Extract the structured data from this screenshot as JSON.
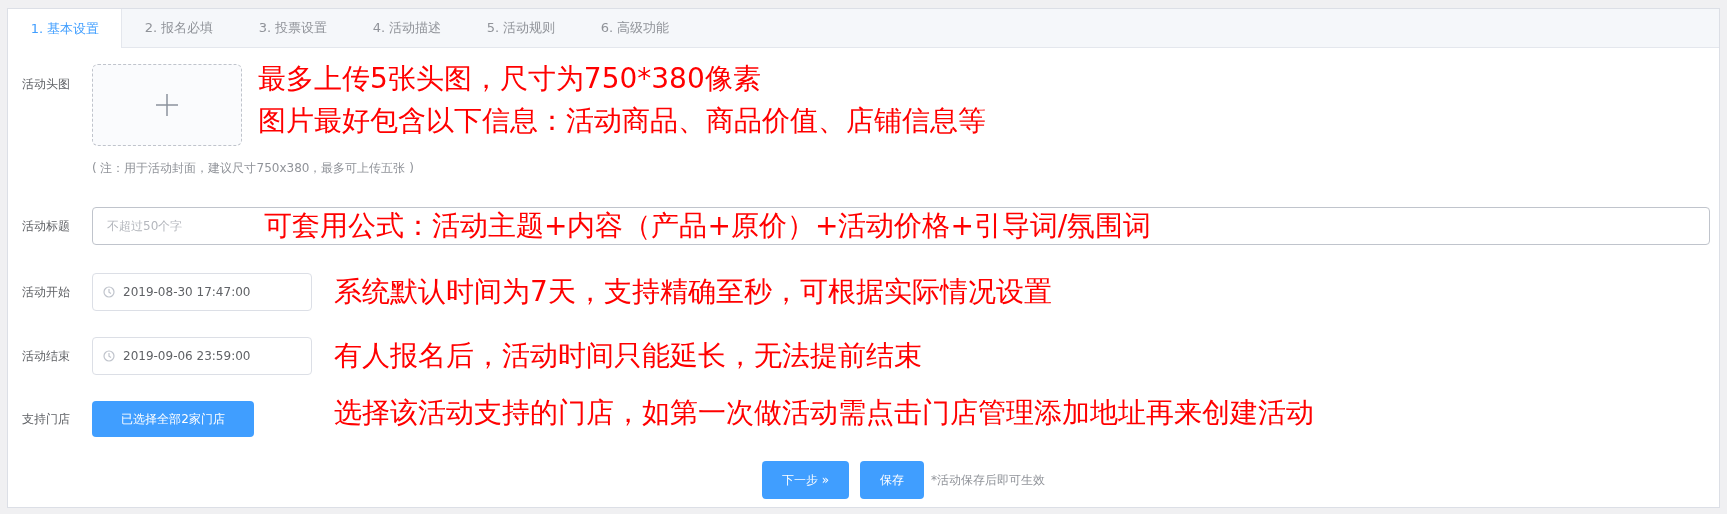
{
  "tabs": [
    {
      "label": "1. 基本设置",
      "selected": true
    },
    {
      "label": "2. 报名必填",
      "selected": false
    },
    {
      "label": "3. 投票设置",
      "selected": false
    },
    {
      "label": "4. 活动描述",
      "selected": false
    },
    {
      "label": "5. 活动规则",
      "selected": false
    },
    {
      "label": "6. 高级功能",
      "selected": false
    }
  ],
  "head_image": {
    "label": "活动头图",
    "annotations": [
      "最多上传5张头图，尺寸为750*380像素",
      "图片最好包含以下信息：活动商品、商品价值、店铺信息等"
    ],
    "note": "( 注：用于活动封面，建议尺寸750x380，最多可上传五张 )"
  },
  "title_field": {
    "label": "活动标题",
    "placeholder": "不超过50个字",
    "annotation": "可套用公式：活动主题+内容（产品+原价）+活动价格+引导词/氛围词"
  },
  "start_field": {
    "label": "活动开始",
    "value": "2019-08-30 17:47:00",
    "annotation": "系统默认时间为7天，支持精确至秒，可根据实际情况设置"
  },
  "end_field": {
    "label": "活动结束",
    "value": "2019-09-06 23:59:00",
    "annotation": "有人报名后，活动时间只能延长，无法提前结束"
  },
  "stores": {
    "label": "支持门店",
    "button": "已选择全部2家门店",
    "annotation": "选择该活动支持的门店，如第一次做活动需点击门店管理添加地址再来创建活动"
  },
  "actions": {
    "next": "下一步",
    "next_icon": "»",
    "save": "保存",
    "hint": "*活动保存后即可生效"
  }
}
